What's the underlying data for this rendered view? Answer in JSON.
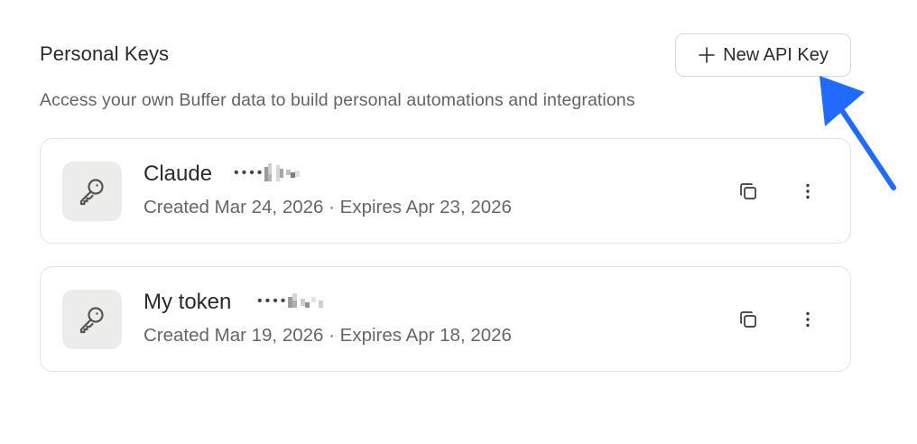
{
  "section": {
    "title": "Personal Keys",
    "description": "Access your own Buffer data to build personal automations and integrations"
  },
  "new_key_button": {
    "label": "New API Key",
    "icon": "plus-icon"
  },
  "keys": [
    {
      "name": "Claude",
      "masked": "••••",
      "meta": "Created Mar 24, 2026 · Expires Apr 23, 2026",
      "icon": "key-icon",
      "actions": [
        "copy-icon",
        "more-vertical-icon"
      ]
    },
    {
      "name": "My token",
      "masked": "••••",
      "meta": "Created Mar 19, 2026 · Expires Apr 18, 2026",
      "icon": "key-icon",
      "actions": [
        "copy-icon",
        "more-vertical-icon"
      ]
    }
  ],
  "annotation": {
    "arrow_color": "#1f6bff"
  }
}
